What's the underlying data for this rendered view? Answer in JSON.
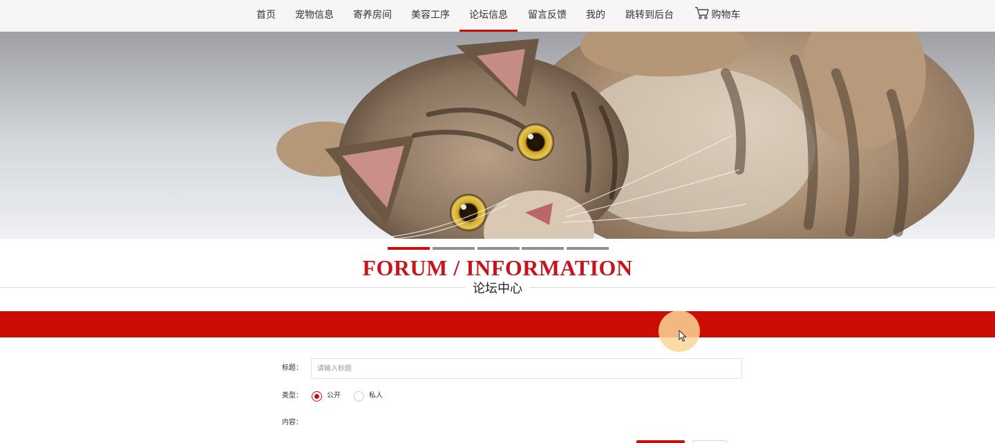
{
  "nav": {
    "items": [
      {
        "label": "首页"
      },
      {
        "label": "宠物信息"
      },
      {
        "label": "寄养房间"
      },
      {
        "label": "美容工序"
      },
      {
        "label": "论坛信息"
      },
      {
        "label": "留言反馈"
      },
      {
        "label": "我的"
      },
      {
        "label": "跳转到后台"
      }
    ],
    "active_label": "论坛信息",
    "cart": {
      "label": "购物车",
      "icon": "cart-icon"
    }
  },
  "banner": {
    "image": "tabby-cat-photo",
    "slides_total": 5,
    "active_slide": 1
  },
  "section": {
    "title_en": "FORUM / INFORMATION",
    "title_cn": "论坛中心"
  },
  "form": {
    "title_label": "标题：",
    "title_placeholder": "请输入标题",
    "title_value": "",
    "type_label": "类型：",
    "type_options": [
      {
        "label": "公开",
        "checked": true
      },
      {
        "label": "私人",
        "checked": false
      }
    ],
    "content_label": "内容："
  },
  "colors": {
    "accent": "#cc0d06",
    "title_red": "#c4161c",
    "nav_bg": "#f7f5f6"
  }
}
